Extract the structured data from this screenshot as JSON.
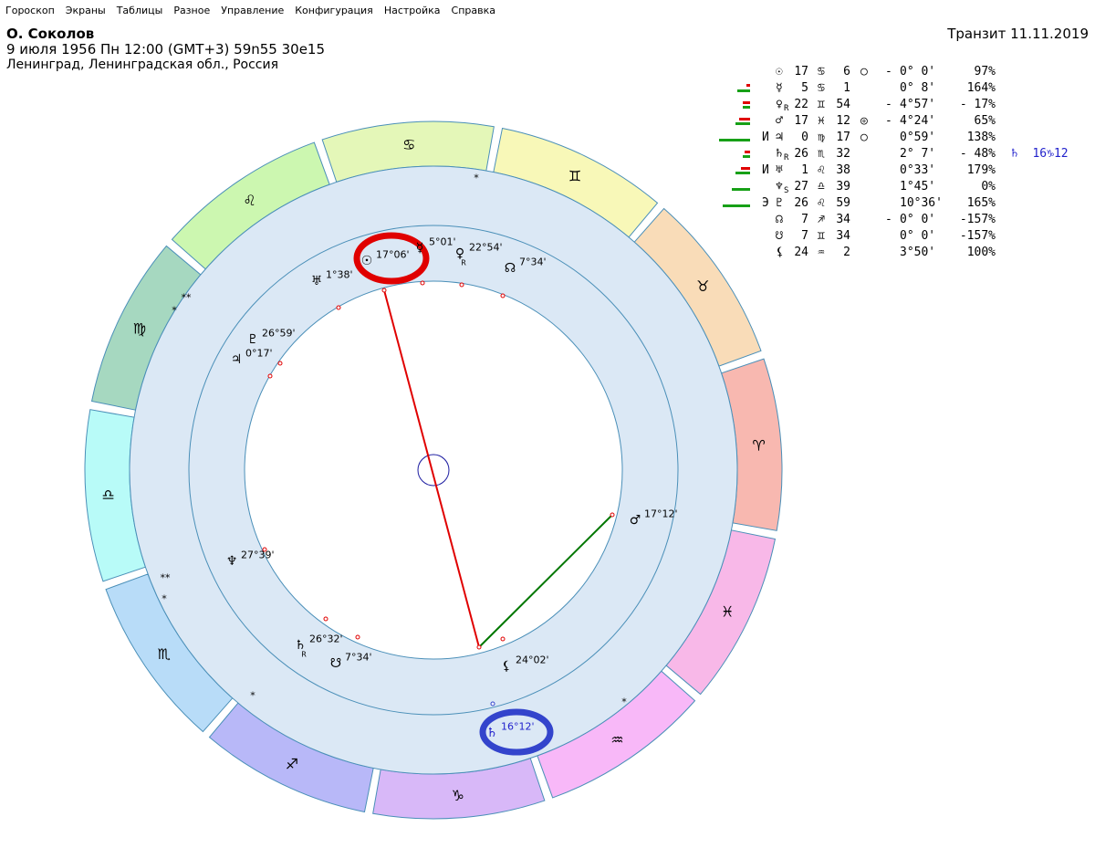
{
  "menu": [
    "Гороскоп",
    "Экраны",
    "Таблицы",
    "Разное",
    "Управление",
    "Конфигурация",
    "Настройка",
    "Справка"
  ],
  "header": {
    "name": "О. Соколов",
    "date_line": "9 июля 1956  Пн  12:00 (GMT+3) 59n55  30e15",
    "location": "Ленинград, Ленинградская обл., Россия",
    "transit": "Транзит 11.11.2019"
  },
  "colors": {
    "accent_red": "#e00000",
    "accent_blue": "#3344cc",
    "line_green": "#007700",
    "bar_green": "#17a017",
    "bar_red": "#e00000",
    "transit_text": "#2222cc"
  },
  "zodiac": [
    {
      "glyph": "♈",
      "color": "#f8b8b0"
    },
    {
      "glyph": "♉",
      "color": "#f9dcb8"
    },
    {
      "glyph": "♊",
      "color": "#f8f8b8"
    },
    {
      "glyph": "♋",
      "color": "#e4f7b8"
    },
    {
      "glyph": "♌",
      "color": "#ccf7b0"
    },
    {
      "glyph": "♍",
      "color": "#a6d8c0"
    },
    {
      "glyph": "♎",
      "color": "#b8fbf8"
    },
    {
      "glyph": "♏",
      "color": "#b8dcf8"
    },
    {
      "glyph": "♐",
      "color": "#b8b8f8"
    },
    {
      "glyph": "♑",
      "color": "#d8b8f8"
    },
    {
      "glyph": "♒",
      "color": "#f8b8f8"
    },
    {
      "glyph": "♓",
      "color": "#f8b8e8"
    }
  ],
  "chart_planets": [
    {
      "glyph": "☉",
      "label": "17°06'",
      "highlight": "red"
    },
    {
      "glyph": "☿",
      "label": "5°01'"
    },
    {
      "glyph": "♀",
      "retro": "R",
      "label": "22°54'"
    },
    {
      "glyph": "☊",
      "label": "7°34'"
    },
    {
      "glyph": "♅",
      "label": "1°38'"
    },
    {
      "glyph": "♇",
      "label": "26°59'"
    },
    {
      "glyph": "♃",
      "label": "0°17'"
    },
    {
      "glyph": "♆",
      "label": "27°39'"
    },
    {
      "glyph": "♄",
      "retro": "R",
      "label": "26°32'"
    },
    {
      "glyph": "☋",
      "label": "7°34'"
    },
    {
      "glyph": "⚸",
      "label": "24°02'"
    },
    {
      "glyph": "♂",
      "label": "17°12'"
    },
    {
      "glyph": "♄",
      "label": "16°12'",
      "transit": true,
      "highlight": "blue"
    }
  ],
  "stars": [
    "*",
    "**",
    "*",
    "**",
    "*",
    "*",
    "*"
  ],
  "planet_table": [
    {
      "pre": "",
      "glyph": "☉",
      "deg": "17",
      "sign": "♋",
      "min": "6",
      "asp": "○",
      "sgn": "-",
      "orb": "0° 0'",
      "pct": "97%",
      "green": 0,
      "red": 0,
      "gtop": 7,
      "rtop": 0
    },
    {
      "pre": "",
      "glyph": "☿",
      "deg": "5",
      "sign": "♋",
      "min": "1",
      "asp": "",
      "sgn": "",
      "orb": "0° 8'",
      "pct": "164%",
      "green": 14,
      "red": 4,
      "gtop": 10,
      "rtop": 4
    },
    {
      "pre": "",
      "glyph": "♀",
      "retro": "R",
      "deg": "22",
      "sign": "♊",
      "min": "54",
      "asp": "",
      "sgn": "-",
      "orb": "4°57'",
      "pct": "- 17%",
      "green": 8,
      "red": 8,
      "gtop": 10,
      "rtop": 5
    },
    {
      "pre": "",
      "glyph": "♂",
      "deg": "17",
      "sign": "♓",
      "min": "12",
      "asp": "◎",
      "sgn": "-",
      "orb": "4°24'",
      "pct": "65%",
      "green": 16,
      "red": 12,
      "gtop": 10,
      "rtop": 5
    },
    {
      "pre": "И",
      "glyph": "♃",
      "deg": "0",
      "sign": "♍",
      "min": "17",
      "asp": "○",
      "sgn": "",
      "orb": "0°59'",
      "pct": "138%",
      "green": 34,
      "red": 0,
      "gtop": 10,
      "rtop": 0
    },
    {
      "pre": "",
      "glyph": "♄",
      "retro": "R",
      "deg": "26",
      "sign": "♏",
      "min": "32",
      "asp": "",
      "sgn": "",
      "orb": "2° 7'",
      "pct": "- 48%",
      "green": 8,
      "red": 6,
      "gtop": 10,
      "rtop": 5,
      "transit": "♄  16♑12"
    },
    {
      "pre": "И",
      "glyph": "♅",
      "deg": "1",
      "sign": "♌",
      "min": "38",
      "asp": "",
      "sgn": "",
      "orb": "0°33'",
      "pct": "179%",
      "green": 16,
      "red": 10,
      "gtop": 10,
      "rtop": 5
    },
    {
      "pre": "",
      "glyph": "♆",
      "retro": "S",
      "deg": "27",
      "sign": "♎",
      "min": "39",
      "asp": "",
      "sgn": "",
      "orb": "1°45'",
      "pct": "0%",
      "green": 20,
      "red": 0,
      "gtop": 10,
      "rtop": 0
    },
    {
      "pre": "Э",
      "glyph": "♇",
      "deg": "26",
      "sign": "♌",
      "min": "59",
      "asp": "",
      "sgn": "",
      "orb": "10°36'",
      "pct": "165%",
      "green": 30,
      "red": 0,
      "gtop": 10,
      "rtop": 0
    },
    {
      "pre": "",
      "glyph": "☊",
      "deg": "7",
      "sign": "♐",
      "min": "34",
      "asp": "",
      "sgn": "-",
      "orb": "0° 0'",
      "pct": "-157%",
      "green": 0,
      "red": 0,
      "gtop": 0,
      "rtop": 0
    },
    {
      "pre": "",
      "glyph": "☋",
      "deg": "7",
      "sign": "♊",
      "min": "34",
      "asp": "",
      "sgn": "",
      "orb": "0° 0'",
      "pct": "-157%",
      "green": 0,
      "red": 0,
      "gtop": 0,
      "rtop": 0
    },
    {
      "pre": "",
      "glyph": "⚸",
      "deg": "24",
      "sign": "♒",
      "min": "2",
      "asp": "",
      "sgn": "",
      "orb": "3°50'",
      "pct": "100%",
      "green": 0,
      "red": 0,
      "gtop": 0,
      "rtop": 0
    }
  ]
}
